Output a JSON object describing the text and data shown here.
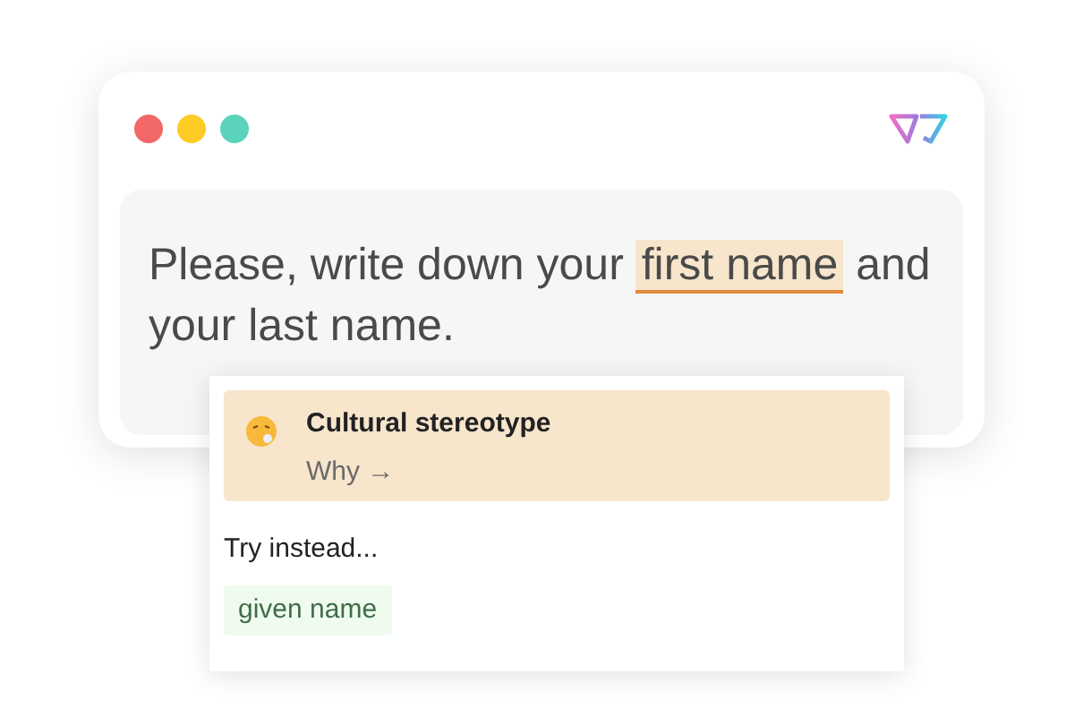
{
  "window_controls": [
    {
      "color": "#f26767"
    },
    {
      "color": "#fdcb24"
    },
    {
      "color": "#5bd3bb"
    }
  ],
  "prompt": {
    "before": "Please, write down your ",
    "highlight": "first name",
    "after": " and your last name."
  },
  "suggestion": {
    "title": "Cultural stereotype",
    "link": "Why →",
    "try_label": "Try instead...",
    "alternatives": [
      "given name"
    ]
  }
}
